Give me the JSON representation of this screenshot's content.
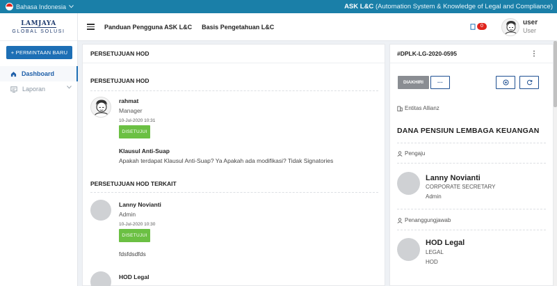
{
  "topbar": {
    "language": "Bahasa Indonesia",
    "app_name": "ASK L&C",
    "app_subtitle": "(Automation System & Knowledge of Legal and Compliance)"
  },
  "logo": {
    "top": "LAMJAYA",
    "bottom": "GLOBAL SOLUSI"
  },
  "sidebar": {
    "new_request": "+ PERMINTAAN BARU",
    "items": [
      {
        "label": "Dashboard",
        "icon": "home-icon",
        "active": true
      },
      {
        "label": "Laporan",
        "icon": "report-icon",
        "active": false
      }
    ]
  },
  "header": {
    "links": [
      "Panduan Pengguna ASK L&C",
      "Basis Pengetahuan L&C"
    ],
    "notification_count": "0",
    "user_name": "user",
    "user_role": "User"
  },
  "left": {
    "card_title": "PERSETUJUAN HOD",
    "section1_title": "PERSETUJUAN HOD",
    "approver": {
      "name": "rahmat",
      "role": "Manager",
      "date": "10-Jul-2020 10:31",
      "status": "DISETUJUI"
    },
    "question_title": "Klausul Anti-Suap",
    "question_text": "Apakah terdapat Klausul Anti-Suap? Ya Apakah ada modifikasi? Tidak Signatories",
    "section2_title": "PERSETUJUAN HOD TERKAIT",
    "related": [
      {
        "name": "Lanny Novianti",
        "role": "Admin",
        "date": "10-Jul-2020 10:30",
        "status": "DISETUJUI",
        "note": "fdsfdsdfds"
      },
      {
        "name": "HOD Legal"
      }
    ]
  },
  "right": {
    "ref": "#DPLK-LG-2020-0595",
    "status_button": "DIAKHIRI",
    "more_button": "···",
    "entity_label": "Entitas Allianz",
    "entity_name": "DANA PENSIUN LEMBAGA KEUANGAN",
    "requester_label": "Pengaju",
    "requester": {
      "name": "Lanny Novianti",
      "dept": "CORPORATE SECRETARY",
      "role": "Admin"
    },
    "pic_label": "Penanggungjawab",
    "pic": {
      "name": "HOD Legal",
      "dept": "LEGAL",
      "role": "HOD"
    }
  },
  "colors": {
    "topbar": "#1a7fa8",
    "primary": "#1d6fb5",
    "approved": "#6bc043",
    "badge": "#e0241c"
  }
}
